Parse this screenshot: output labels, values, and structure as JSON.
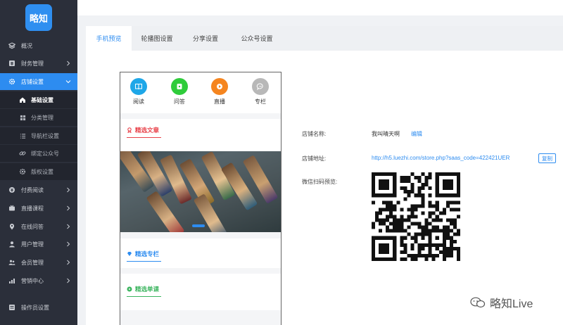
{
  "sidebar": {
    "logo_text": "略知",
    "items": [
      {
        "label": "概况",
        "icon": "layers-icon"
      },
      {
        "label": "财务管理",
        "icon": "finance-icon"
      },
      {
        "label": "店铺设置",
        "icon": "gear-icon"
      },
      {
        "label": "付费阅读",
        "icon": "paid-read-icon"
      },
      {
        "label": "直播课程",
        "icon": "live-icon"
      },
      {
        "label": "在线问答",
        "icon": "location-icon"
      },
      {
        "label": "用户管理",
        "icon": "user-icon"
      },
      {
        "label": "会员管理",
        "icon": "members-icon"
      },
      {
        "label": "营销中心",
        "icon": "marketing-icon"
      },
      {
        "label": "操作员设置",
        "icon": "operator-icon"
      }
    ],
    "sub_items": [
      {
        "label": "基础设置",
        "icon": "home-icon"
      },
      {
        "label": "分类管理",
        "icon": "grid-icon"
      },
      {
        "label": "导航栏设置",
        "icon": "list-icon"
      },
      {
        "label": "绑定公众号",
        "icon": "link-icon"
      },
      {
        "label": "版权设置",
        "icon": "gear-icon"
      }
    ]
  },
  "tabs": [
    "手机预览",
    "轮播图设置",
    "分享设置",
    "公众号设置"
  ],
  "phone": {
    "quick": [
      "阅读",
      "问答",
      "直播",
      "专栏"
    ],
    "sections": [
      "精选文章",
      "精选专栏",
      "精选单课"
    ]
  },
  "info": {
    "name_label": "店铺名称:",
    "name_value": "我叫晴天啊",
    "edit_link": "编辑",
    "addr_label": "店铺地址:",
    "addr_value": "http://h5.luezhi.com/store.php?saas_code=422421UER",
    "copy_button": "复制",
    "qr_label": "微信扫码预览:"
  },
  "watermark": "略知Live",
  "colors": {
    "accent": "#2d8cf0",
    "sidebar_bg": "#2b2f3a",
    "read": "#1ea7e8",
    "qa": "#2fcc3b",
    "live": "#f5851f",
    "column": "#b8b8b8",
    "article_title": "#e8424a",
    "column_title": "#2d8cf0",
    "lesson_title": "#3cb55f"
  }
}
